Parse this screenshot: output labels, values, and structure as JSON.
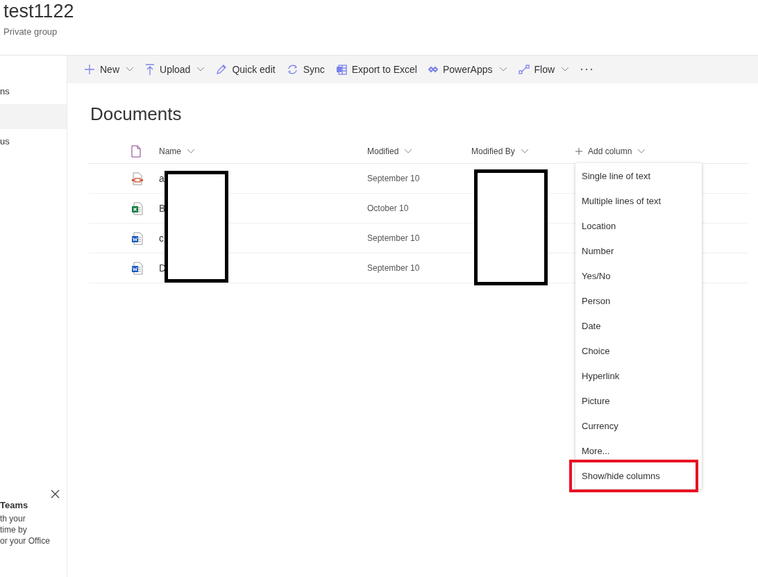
{
  "site": {
    "title": "test1122",
    "subtitle": "Private group"
  },
  "nav": {
    "items": [
      {
        "label": "ns",
        "selected": false
      },
      {
        "selected": true
      },
      {
        "label": "us",
        "selected": false
      }
    ]
  },
  "teams_card": {
    "title": "Teams",
    "lines": [
      "th your",
      "time by",
      "or your Office"
    ]
  },
  "toolbar": [
    {
      "kind": "new",
      "label": "New",
      "dropdown": true
    },
    {
      "kind": "upload",
      "label": "Upload",
      "dropdown": true
    },
    {
      "kind": "edit",
      "label": "Quick edit",
      "dropdown": false
    },
    {
      "kind": "sync",
      "label": "Sync",
      "dropdown": false
    },
    {
      "kind": "excel",
      "label": "Export to Excel",
      "dropdown": false
    },
    {
      "kind": "powerapps",
      "label": "PowerApps",
      "dropdown": true
    },
    {
      "kind": "flow",
      "label": "Flow",
      "dropdown": true
    },
    {
      "kind": "more"
    }
  ],
  "library": {
    "title": "Documents",
    "columns": [
      {
        "kind": "text",
        "label": "Name"
      },
      {
        "kind": "text",
        "label": "Modified"
      },
      {
        "kind": "text",
        "label": "Modified By"
      },
      {
        "kind": "add",
        "label": "Add column"
      }
    ],
    "rows": [
      {
        "kind": "slides",
        "name": "a",
        "modified": "September 10"
      },
      {
        "kind": "sheet",
        "name": "B",
        "modified": "October 10"
      },
      {
        "kind": "word",
        "name": "c",
        "modified": "September 10"
      },
      {
        "kind": "word",
        "name": "D",
        "modified": "September 10"
      }
    ]
  },
  "add_column_menu": {
    "items": [
      {
        "label": "Single line of text",
        "highlighted": false
      },
      {
        "label": "Multiple lines of text",
        "highlighted": false
      },
      {
        "label": "Location",
        "highlighted": false
      },
      {
        "label": "Number",
        "highlighted": false
      },
      {
        "label": "Yes/No",
        "highlighted": false
      },
      {
        "label": "Person",
        "highlighted": false
      },
      {
        "label": "Date",
        "highlighted": false
      },
      {
        "label": "Choice",
        "highlighted": false
      },
      {
        "label": "Hyperlink",
        "highlighted": false
      },
      {
        "label": "Picture",
        "highlighted": false
      },
      {
        "label": "Currency",
        "highlighted": false
      },
      {
        "label": "More...",
        "highlighted": false
      },
      {
        "label": "Show/hide columns",
        "highlighted": true
      }
    ]
  }
}
